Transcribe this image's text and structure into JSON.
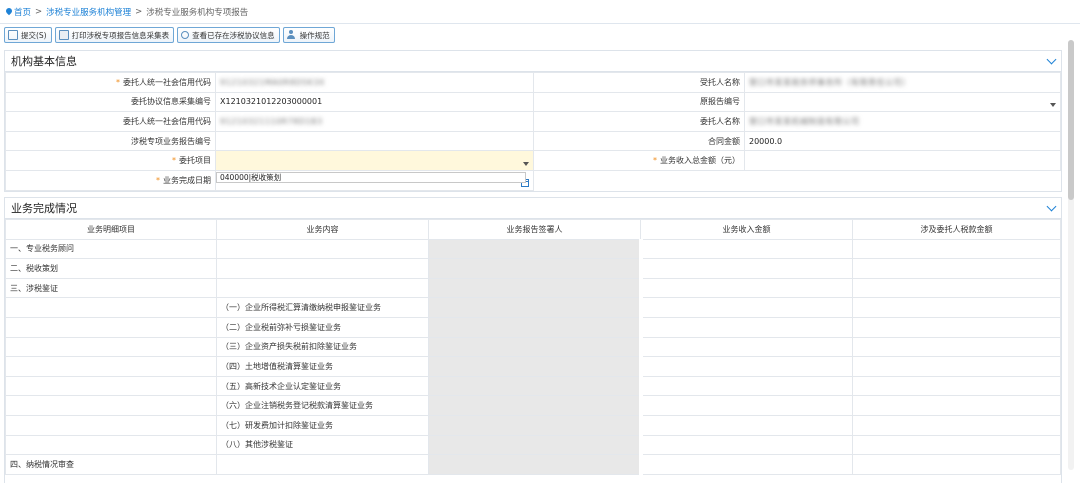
{
  "breadcrumb": {
    "home": "首页",
    "sep": ">",
    "level1": "涉税专业服务机构管理",
    "current": "涉税专业服务机构专项报告"
  },
  "toolbar": {
    "submit": "提交(S)",
    "print": "打印涉税专项报告信息采集表",
    "view": "查看已存在涉税协议信息",
    "guide": "操作规范"
  },
  "section1": {
    "title": "机构基本信息",
    "rows": [
      {
        "l1": "委托人统一社会信用代码",
        "v1": "91210321MA0R8D5K3X",
        "l2": "受托人名称",
        "v2": "营口市某某税务师事务所（有限责任公司）",
        "req1": true
      },
      {
        "l1": "委托协议信息采集编号",
        "v1": "X1210321012203000001",
        "l2": "原报告编号",
        "v2": ""
      },
      {
        "l1": "委托人统一社会信用代码",
        "v1": "91210321110R78D1B3",
        "l2": "委托人名称",
        "v2": "营口市某某机械制造有限公司"
      },
      {
        "l1": "涉税专项业务报告编号",
        "v1": "",
        "l2": "合同金额",
        "v2": "20000.0"
      },
      {
        "l1": "委托项目",
        "v1": "",
        "l2": "业务收入总金额（元）",
        "v2": "",
        "req1": true,
        "req2": true
      },
      {
        "l1": "业务完成日期",
        "v1": "",
        "req1": true
      }
    ],
    "dropdown_option": "040000|税收策划"
  },
  "section2": {
    "title": "业务完成情况",
    "headers": [
      "业务明细项目",
      "业务内容",
      "业务报告签署人",
      "业务收入金额",
      "涉及委托人税款金额"
    ],
    "rows": [
      {
        "item": "一、专业税务顾问",
        "content": ""
      },
      {
        "item": "二、税收策划",
        "content": ""
      },
      {
        "item": "三、涉税鉴证",
        "content": ""
      },
      {
        "item": "",
        "content": "（一）企业所得税汇算清缴纳税申报鉴证业务"
      },
      {
        "item": "",
        "content": "（二）企业税前弥补亏损鉴证业务"
      },
      {
        "item": "",
        "content": "（三）企业资产损失税前扣除鉴证业务"
      },
      {
        "item": "",
        "content": "（四）土地增值税清算鉴证业务"
      },
      {
        "item": "",
        "content": "（五）高新技术企业认定鉴证业务"
      },
      {
        "item": "",
        "content": "（六）企业注销税务登记税款清算鉴证业务"
      },
      {
        "item": "",
        "content": "（七）研发费加计扣除鉴证业务"
      },
      {
        "item": "",
        "content": "（八）其他涉税鉴证"
      },
      {
        "item": "四、纳税情况审查",
        "content": ""
      }
    ]
  }
}
